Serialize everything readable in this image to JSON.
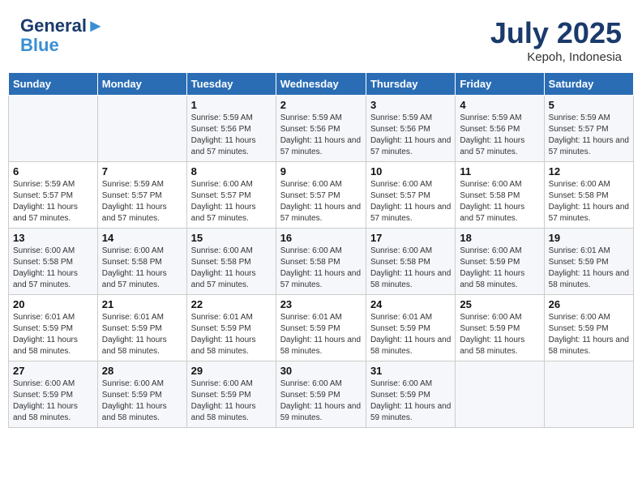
{
  "header": {
    "logo_line1": "General",
    "logo_line2": "Blue",
    "month_year": "July 2025",
    "location": "Kepoh, Indonesia"
  },
  "weekdays": [
    "Sunday",
    "Monday",
    "Tuesday",
    "Wednesday",
    "Thursday",
    "Friday",
    "Saturday"
  ],
  "weeks": [
    [
      {
        "day": "",
        "info": ""
      },
      {
        "day": "",
        "info": ""
      },
      {
        "day": "1",
        "info": "Sunrise: 5:59 AM\nSunset: 5:56 PM\nDaylight: 11 hours and 57 minutes."
      },
      {
        "day": "2",
        "info": "Sunrise: 5:59 AM\nSunset: 5:56 PM\nDaylight: 11 hours and 57 minutes."
      },
      {
        "day": "3",
        "info": "Sunrise: 5:59 AM\nSunset: 5:56 PM\nDaylight: 11 hours and 57 minutes."
      },
      {
        "day": "4",
        "info": "Sunrise: 5:59 AM\nSunset: 5:56 PM\nDaylight: 11 hours and 57 minutes."
      },
      {
        "day": "5",
        "info": "Sunrise: 5:59 AM\nSunset: 5:57 PM\nDaylight: 11 hours and 57 minutes."
      }
    ],
    [
      {
        "day": "6",
        "info": "Sunrise: 5:59 AM\nSunset: 5:57 PM\nDaylight: 11 hours and 57 minutes."
      },
      {
        "day": "7",
        "info": "Sunrise: 5:59 AM\nSunset: 5:57 PM\nDaylight: 11 hours and 57 minutes."
      },
      {
        "day": "8",
        "info": "Sunrise: 6:00 AM\nSunset: 5:57 PM\nDaylight: 11 hours and 57 minutes."
      },
      {
        "day": "9",
        "info": "Sunrise: 6:00 AM\nSunset: 5:57 PM\nDaylight: 11 hours and 57 minutes."
      },
      {
        "day": "10",
        "info": "Sunrise: 6:00 AM\nSunset: 5:57 PM\nDaylight: 11 hours and 57 minutes."
      },
      {
        "day": "11",
        "info": "Sunrise: 6:00 AM\nSunset: 5:58 PM\nDaylight: 11 hours and 57 minutes."
      },
      {
        "day": "12",
        "info": "Sunrise: 6:00 AM\nSunset: 5:58 PM\nDaylight: 11 hours and 57 minutes."
      }
    ],
    [
      {
        "day": "13",
        "info": "Sunrise: 6:00 AM\nSunset: 5:58 PM\nDaylight: 11 hours and 57 minutes."
      },
      {
        "day": "14",
        "info": "Sunrise: 6:00 AM\nSunset: 5:58 PM\nDaylight: 11 hours and 57 minutes."
      },
      {
        "day": "15",
        "info": "Sunrise: 6:00 AM\nSunset: 5:58 PM\nDaylight: 11 hours and 57 minutes."
      },
      {
        "day": "16",
        "info": "Sunrise: 6:00 AM\nSunset: 5:58 PM\nDaylight: 11 hours and 57 minutes."
      },
      {
        "day": "17",
        "info": "Sunrise: 6:00 AM\nSunset: 5:58 PM\nDaylight: 11 hours and 58 minutes."
      },
      {
        "day": "18",
        "info": "Sunrise: 6:00 AM\nSunset: 5:59 PM\nDaylight: 11 hours and 58 minutes."
      },
      {
        "day": "19",
        "info": "Sunrise: 6:01 AM\nSunset: 5:59 PM\nDaylight: 11 hours and 58 minutes."
      }
    ],
    [
      {
        "day": "20",
        "info": "Sunrise: 6:01 AM\nSunset: 5:59 PM\nDaylight: 11 hours and 58 minutes."
      },
      {
        "day": "21",
        "info": "Sunrise: 6:01 AM\nSunset: 5:59 PM\nDaylight: 11 hours and 58 minutes."
      },
      {
        "day": "22",
        "info": "Sunrise: 6:01 AM\nSunset: 5:59 PM\nDaylight: 11 hours and 58 minutes."
      },
      {
        "day": "23",
        "info": "Sunrise: 6:01 AM\nSunset: 5:59 PM\nDaylight: 11 hours and 58 minutes."
      },
      {
        "day": "24",
        "info": "Sunrise: 6:01 AM\nSunset: 5:59 PM\nDaylight: 11 hours and 58 minutes."
      },
      {
        "day": "25",
        "info": "Sunrise: 6:00 AM\nSunset: 5:59 PM\nDaylight: 11 hours and 58 minutes."
      },
      {
        "day": "26",
        "info": "Sunrise: 6:00 AM\nSunset: 5:59 PM\nDaylight: 11 hours and 58 minutes."
      }
    ],
    [
      {
        "day": "27",
        "info": "Sunrise: 6:00 AM\nSunset: 5:59 PM\nDaylight: 11 hours and 58 minutes."
      },
      {
        "day": "28",
        "info": "Sunrise: 6:00 AM\nSunset: 5:59 PM\nDaylight: 11 hours and 58 minutes."
      },
      {
        "day": "29",
        "info": "Sunrise: 6:00 AM\nSunset: 5:59 PM\nDaylight: 11 hours and 58 minutes."
      },
      {
        "day": "30",
        "info": "Sunrise: 6:00 AM\nSunset: 5:59 PM\nDaylight: 11 hours and 59 minutes."
      },
      {
        "day": "31",
        "info": "Sunrise: 6:00 AM\nSunset: 5:59 PM\nDaylight: 11 hours and 59 minutes."
      },
      {
        "day": "",
        "info": ""
      },
      {
        "day": "",
        "info": ""
      }
    ]
  ]
}
